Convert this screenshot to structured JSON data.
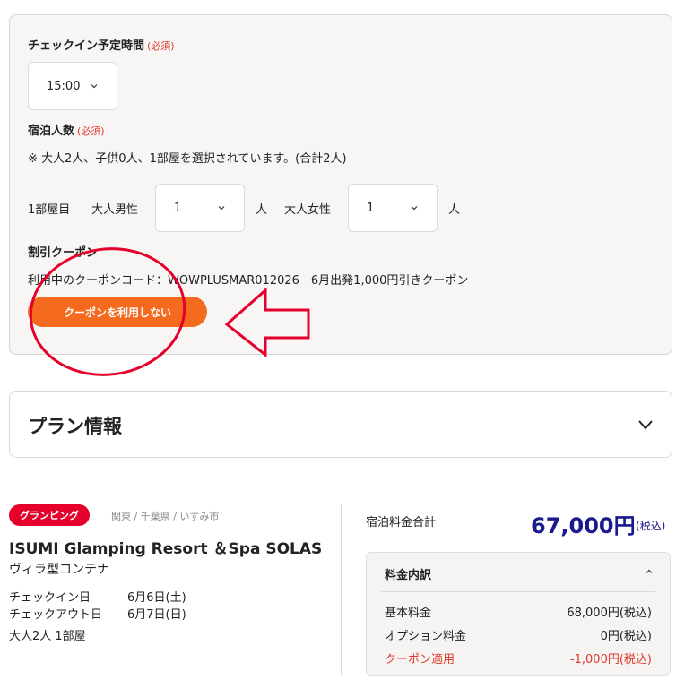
{
  "checkin": {
    "label": "チェックイン予定時間",
    "required": "(必須)",
    "time_value": "15:00"
  },
  "guests": {
    "label": "宿泊人数",
    "required": "(必須)",
    "note": "※ 大人2人、子供0人、1部屋を選択されています。(合計2人)",
    "room_label": "1部屋目",
    "male_label": "大人男性",
    "male_value": "1",
    "female_label": "大人女性",
    "female_value": "1",
    "unit": "人"
  },
  "coupon": {
    "label": "割引クーポン",
    "info": "利用中のクーポンコード：WOWPLUSMAR012026　6月出発1,000円引きクーポン",
    "button_label": "クーポンを利用しない"
  },
  "plan": {
    "title": "プラン情報"
  },
  "hotel": {
    "badge": "グランピング",
    "location": "関東 / 千葉県 / いすみ市",
    "name": "ISUMI Glamping Resort ＆Spa SOLAS",
    "room_type": "ヴィラ型コンテナ",
    "checkin_label": "チェックイン日",
    "checkin_date": "6月6日(土)",
    "checkout_label": "チェックアウト日",
    "checkout_date": "6月7日(日)",
    "guests_summary": "大人2人 1部屋"
  },
  "price": {
    "total_label": "宿泊料金合計",
    "total_value": "67,000円",
    "total_tax": "(税込)",
    "breakdown_title": "料金内訳",
    "rows": [
      {
        "label": "基本料金",
        "value": "68,000円(税込)"
      },
      {
        "label": "オプション料金",
        "value": "0円(税込)"
      },
      {
        "label": "クーポン適用",
        "value": "-1,000円(税込)"
      }
    ]
  },
  "colors": {
    "accent_orange": "#f46a1f",
    "badge_red": "#e4002b",
    "price_navy": "#1a1a8c",
    "annotation_red": "#e4002b"
  }
}
